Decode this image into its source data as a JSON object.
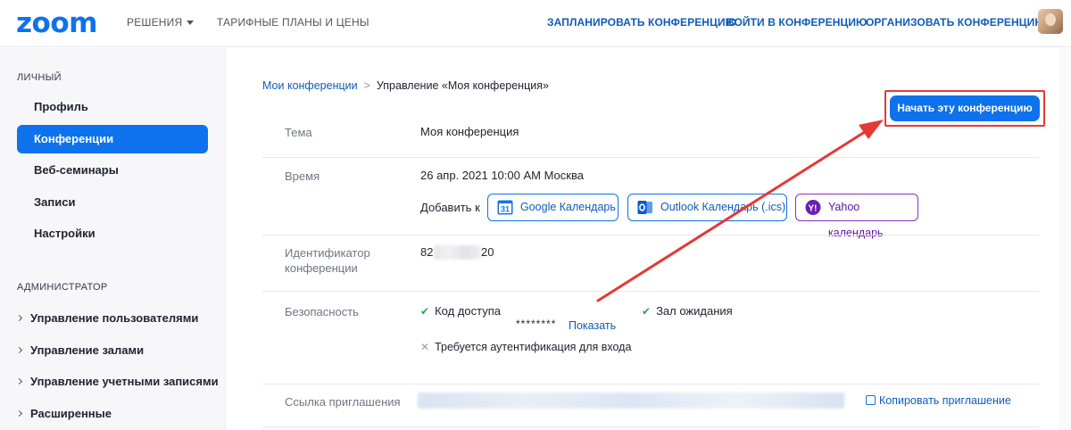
{
  "logo": "zoom",
  "topnav": {
    "solutions": "РЕШЕНИЯ",
    "plans": "ТАРИФНЫЕ ПЛАНЫ И ЦЕНЫ",
    "schedule": "ЗАПЛАНИРОВАТЬ КОНФЕРЕНЦИЮ",
    "join": "ВОЙТИ В КОНФЕРЕНЦИЮ",
    "host": "ОРГАНИЗОВАТЬ КОНФЕРЕНЦИЮ"
  },
  "sidebar": {
    "personal_title": "ЛИЧНЫЙ",
    "personal_items": [
      {
        "label": "Профиль"
      },
      {
        "label": "Конференции"
      },
      {
        "label": "Веб-семинары"
      },
      {
        "label": "Записи"
      },
      {
        "label": "Настройки"
      }
    ],
    "admin_title": "АДМИНИСТРАТОР",
    "admin_items": [
      {
        "label": "Управление пользователями"
      },
      {
        "label": "Управление залами"
      },
      {
        "label": "Управление учетными записями"
      },
      {
        "label": "Расширенные"
      }
    ]
  },
  "breadcrumb": {
    "parent": "Мои конференции",
    "separator": ">",
    "current": "Управление «Моя конференция»"
  },
  "start_button": "Начать эту конференцию",
  "topic": {
    "label": "Тема",
    "value": "Моя конференция"
  },
  "time": {
    "label": "Время",
    "value": "26 апр. 2021 10:00 AM Москва",
    "add_to": "Добавить к",
    "google": "Google Календарь",
    "outlook": "Outlook Календарь (.ics)",
    "yahoo": "Yahoo календарь"
  },
  "meeting_id": {
    "label": "Идентификатор конференции",
    "prefix": "82",
    "suffix": "20"
  },
  "security": {
    "label": "Безопасность",
    "passcode": "Код доступа",
    "passcode_masked": "********",
    "show": "Показать",
    "waiting_room": "Зал ожидания",
    "auth_required": "Требуется аутентификация для входа"
  },
  "invite": {
    "label": "Ссылка приглашения",
    "copy": "Копировать приглашение"
  },
  "colors": {
    "brand_blue": "#0e72ed",
    "highlight_red": "#e53935"
  }
}
